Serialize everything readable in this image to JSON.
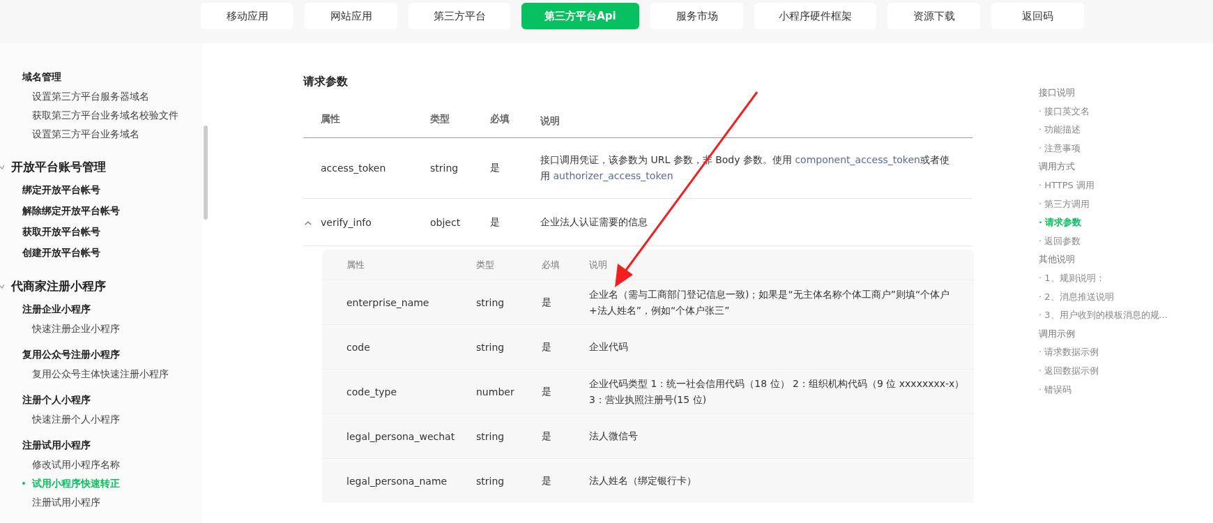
{
  "nav": [
    {
      "label": "移动应用",
      "selected": false
    },
    {
      "label": "网站应用",
      "selected": false
    },
    {
      "label": "第三方平台",
      "selected": false
    },
    {
      "label": "第三方平台Api",
      "selected": true
    },
    {
      "label": "服务市场",
      "selected": false
    },
    {
      "label": "小程序硬件框架",
      "selected": false
    },
    {
      "label": "资源下载",
      "selected": false
    },
    {
      "label": "返回码",
      "selected": false
    }
  ],
  "sidebar": {
    "items": [
      {
        "label": "域名管理",
        "kind": "group",
        "children": [
          {
            "label": "设置第三方平台服务器域名",
            "kind": "page",
            "selected": false
          },
          {
            "label": "获取第三方平台业务域名校验文件",
            "kind": "page",
            "selected": false
          },
          {
            "label": "设置第三方平台业务域名",
            "kind": "page",
            "selected": false
          }
        ]
      },
      {
        "label": "开放平台账号管理",
        "kind": "section",
        "expanded": true,
        "children": [
          {
            "label": "绑定开放平台帐号",
            "kind": "group"
          },
          {
            "label": "解除绑定开放平台帐号",
            "kind": "group"
          },
          {
            "label": "获取开放平台帐号",
            "kind": "group"
          },
          {
            "label": "创建开放平台帐号",
            "kind": "group"
          }
        ]
      },
      {
        "label": "代商家注册小程序",
        "kind": "section",
        "expanded": true,
        "children": [
          {
            "label": "注册企业小程序",
            "kind": "group",
            "children": [
              {
                "label": "快速注册企业小程序",
                "kind": "page",
                "selected": false
              }
            ]
          },
          {
            "label": "复用公众号注册小程序",
            "kind": "group",
            "children": [
              {
                "label": "复用公众号主体快速注册小程序",
                "kind": "page",
                "selected": false
              }
            ]
          },
          {
            "label": "注册个人小程序",
            "kind": "group",
            "children": [
              {
                "label": "快速注册个人小程序",
                "kind": "page",
                "selected": false
              }
            ]
          },
          {
            "label": "注册试用小程序",
            "kind": "group",
            "children": [
              {
                "label": "修改试用小程序名称",
                "kind": "page",
                "selected": false
              },
              {
                "label": "试用小程序快速转正",
                "kind": "page",
                "selected": true
              },
              {
                "label": "注册试用小程序",
                "kind": "page",
                "selected": false
              }
            ]
          }
        ]
      }
    ]
  },
  "section_title": "请求参数",
  "table": {
    "columns": [
      "属性",
      "类型",
      "必填",
      "说明"
    ],
    "rows": [
      {
        "name": "access_token",
        "type": "string",
        "required": "是",
        "description": "接口调用凭证，该参数为 URL 参数，非 Body 参数。使用 ",
        "links": [
          "component_access_token",
          "authorizer_access_token"
        ],
        "link_joiner": "或者使用"
      },
      {
        "name": "verify_info",
        "type": "object",
        "required": "是",
        "description": "企业法人认证需要的信息",
        "expanded": true,
        "sub_table": {
          "columns": [
            "属性",
            "类型",
            "必填",
            "说明"
          ],
          "rows": [
            {
              "name": "enterprise_name",
              "type": "string",
              "required": "是",
              "description": "企业名（需与工商部门登记信息一致)；如果是“无主体名称个体工商户”则填“个体户+法人姓名”，例如“个体户张三”"
            },
            {
              "name": "code",
              "type": "string",
              "required": "是",
              "description": "企业代码"
            },
            {
              "name": "code_type",
              "type": "number",
              "required": "是",
              "description": "企业代码类型 1：统一社会信用代码（18 位） 2：组织机构代码（9 位 xxxxxxxx-x） 3：营业执照注册号(15 位)"
            },
            {
              "name": "legal_persona_wechat",
              "type": "string",
              "required": "是",
              "description": "法人微信号"
            },
            {
              "name": "legal_persona_name",
              "type": "string",
              "required": "是",
              "description": "法人姓名（绑定银行卡）"
            }
          ]
        }
      }
    ]
  },
  "toc": [
    {
      "label": "接口说明",
      "kind": "heading",
      "selected": false
    },
    {
      "label": "· 接口英文名",
      "kind": "item",
      "selected": false
    },
    {
      "label": "· 功能描述",
      "kind": "item",
      "selected": false
    },
    {
      "label": "· 注意事项",
      "kind": "item",
      "selected": false
    },
    {
      "label": "调用方式",
      "kind": "heading",
      "selected": false
    },
    {
      "label": "· HTTPS 调用",
      "kind": "item",
      "selected": false
    },
    {
      "label": "· 第三方调用",
      "kind": "item",
      "selected": false
    },
    {
      "label": "· 请求参数",
      "kind": "item",
      "selected": true
    },
    {
      "label": "· 返回参数",
      "kind": "item",
      "selected": false
    },
    {
      "label": "其他说明",
      "kind": "heading",
      "selected": false
    },
    {
      "label": "· 1、规则说明：",
      "kind": "item",
      "selected": false
    },
    {
      "label": "· 2、消息推送说明",
      "kind": "item",
      "selected": false
    },
    {
      "label": "· 3、用户收到的模板消息的规...",
      "kind": "item",
      "selected": false
    },
    {
      "label": "调用示例",
      "kind": "heading",
      "selected": false
    },
    {
      "label": "· 请求数据示例",
      "kind": "item",
      "selected": false
    },
    {
      "label": "· 返回数据示例",
      "kind": "item",
      "selected": false
    },
    {
      "label": "· 错误码",
      "kind": "item",
      "selected": false
    }
  ]
}
